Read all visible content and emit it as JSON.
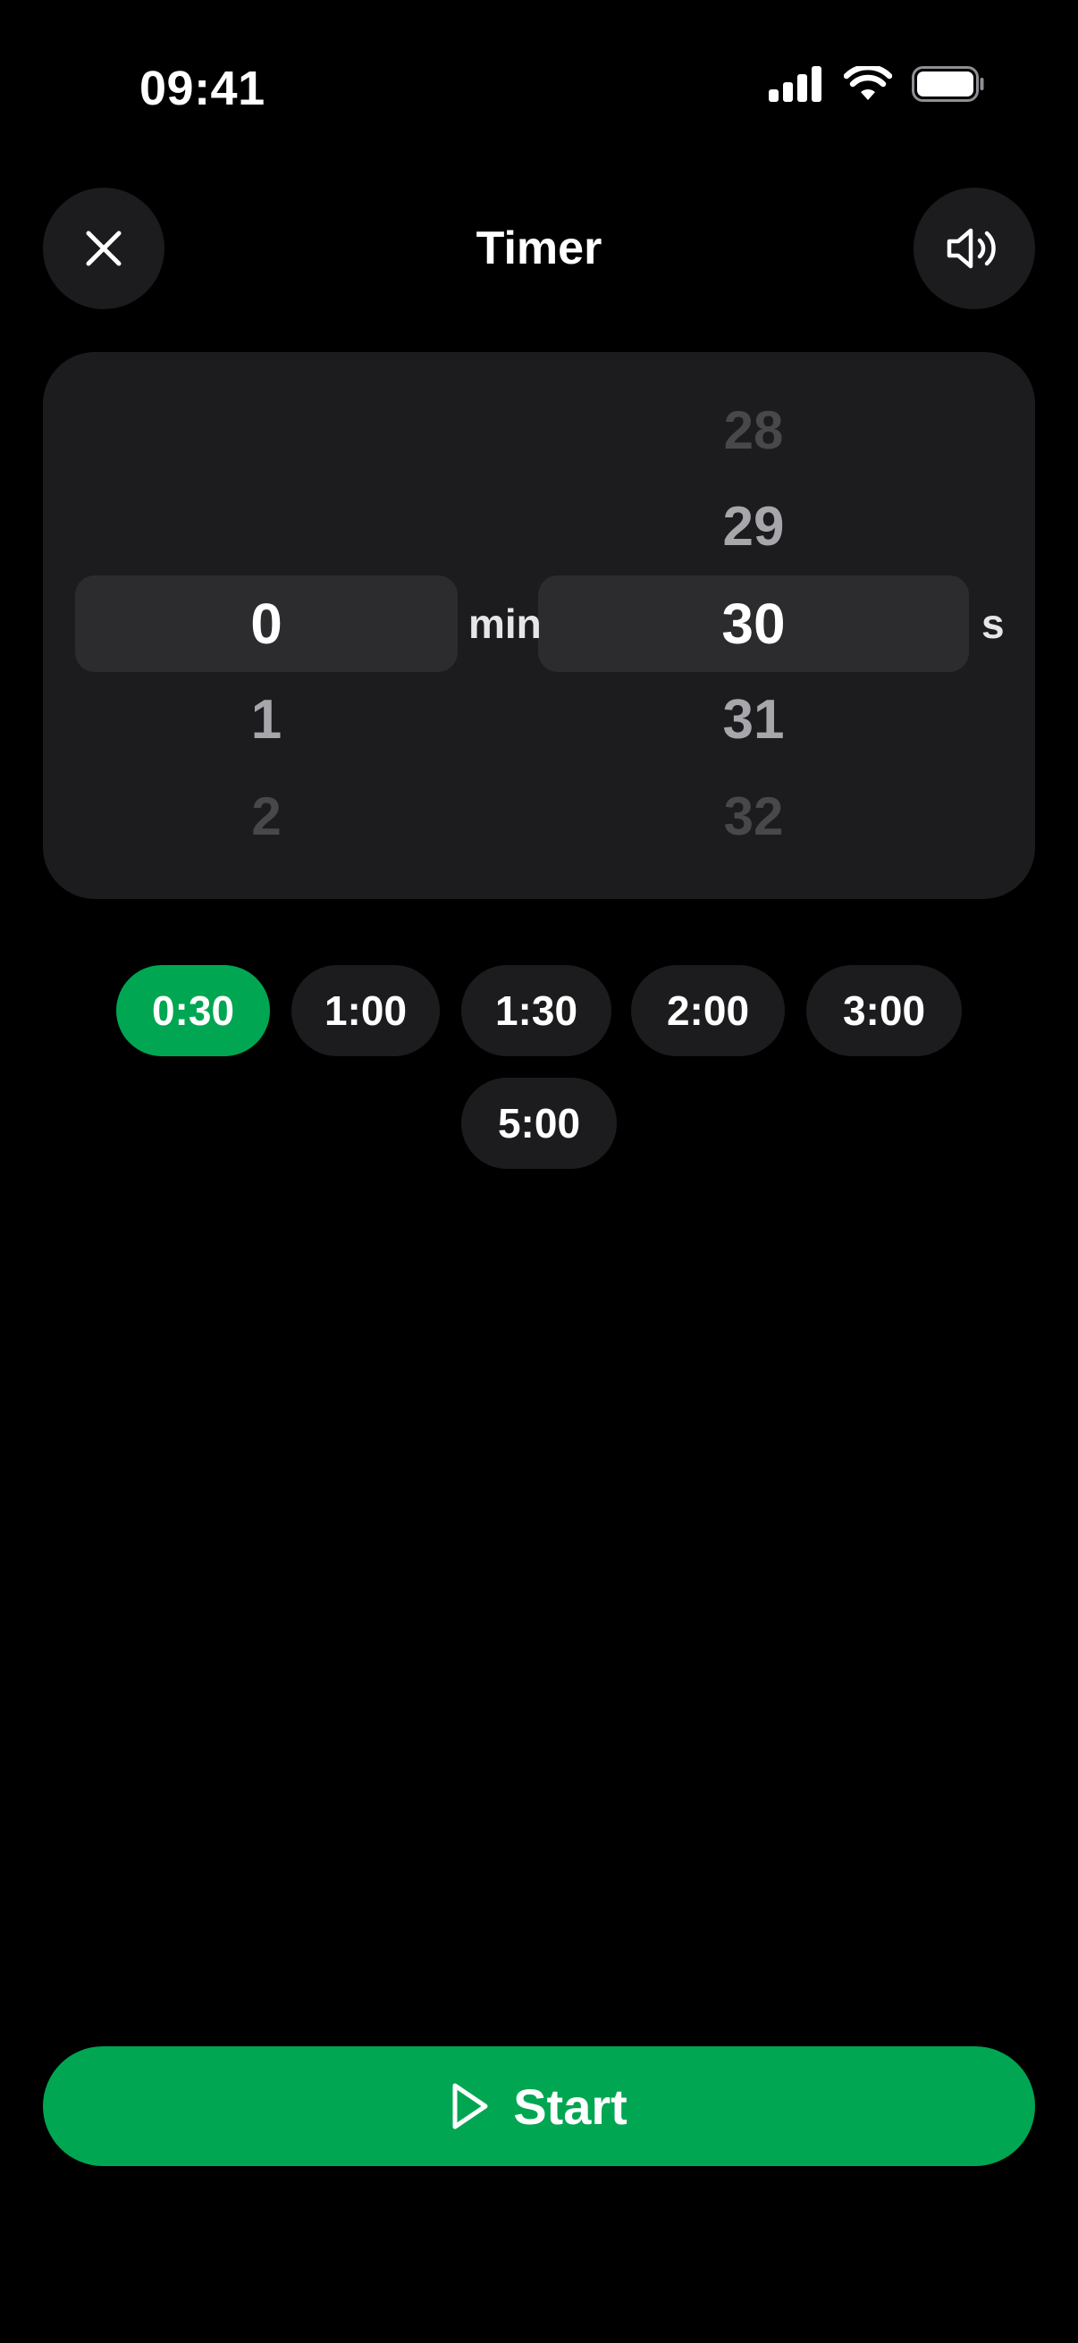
{
  "status_bar": {
    "time": "09:41",
    "icons": [
      "cellular-signal-icon",
      "wifi-icon",
      "battery-icon"
    ]
  },
  "header": {
    "title": "Timer",
    "left_icon": "close-icon",
    "right_icon": "speaker-volume-icon"
  },
  "picker": {
    "minutes": {
      "above": [
        "",
        ""
      ],
      "selected": "0",
      "below": [
        "1",
        "2"
      ],
      "unit": "min"
    },
    "seconds": {
      "above": [
        "28",
        "29"
      ],
      "selected": "30",
      "below": [
        "31",
        "32"
      ],
      "unit": "s"
    }
  },
  "presets": [
    {
      "label": "0:30",
      "active": true
    },
    {
      "label": "1:00",
      "active": false
    },
    {
      "label": "1:30",
      "active": false
    },
    {
      "label": "2:00",
      "active": false
    },
    {
      "label": "3:00",
      "active": false
    },
    {
      "label": "5:00",
      "active": false
    }
  ],
  "start_button": {
    "label": "Start",
    "icon": "play-icon"
  },
  "colors": {
    "background": "#000000",
    "surface": "#1c1c1e",
    "selection": "#2c2c2e",
    "accent": "#00a651"
  }
}
